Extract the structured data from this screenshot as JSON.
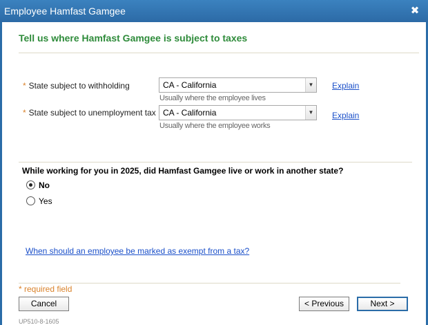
{
  "window": {
    "title": "Employee Hamfast Gamgee",
    "close_glyph": "✖"
  },
  "page": {
    "heading": "Tell us where Hamfast Gamgee is subject to taxes"
  },
  "fields": {
    "withholding": {
      "required_mark": "*",
      "label": "State subject to withholding",
      "value": "CA - California",
      "hint": "Usually where the employee lives",
      "explain": "Explain"
    },
    "unemployment": {
      "required_mark": "*",
      "label": "State subject to unemployment tax",
      "value": "CA - California",
      "hint": "Usually where the employee works",
      "explain": "Explain"
    }
  },
  "question": {
    "text": "While working for you in 2025, did Hamfast Gamgee live or work in another state?",
    "options": [
      {
        "label": "No",
        "selected": true
      },
      {
        "label": "Yes",
        "selected": false
      }
    ]
  },
  "help_link": "When should an employee be marked as exempt from a tax?",
  "footer": {
    "required_note": "* required field",
    "cancel": "Cancel",
    "previous": "< Previous",
    "next": "Next >",
    "version": "UP510-8-1605"
  }
}
